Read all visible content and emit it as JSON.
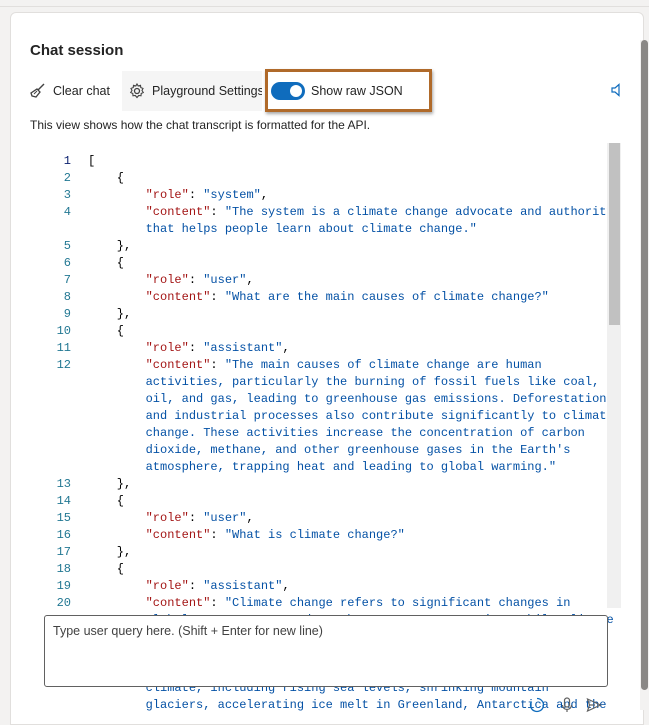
{
  "panel": {
    "title": "Chat session",
    "description": "This view shows how the chat transcript is formatted for the API."
  },
  "toolbar": {
    "clear_label": "Clear chat",
    "settings_label": "Playground Settings",
    "toggle_label": "Show raw JSON",
    "toggle_on": true
  },
  "colors": {
    "accent": "#0f6cbd",
    "highlight_border": "#b06a2a",
    "json_key": "#a31515",
    "json_string": "#0451a5",
    "line_number": "#237893"
  },
  "icons": [
    "broom-icon",
    "gear-icon",
    "speaker-icon",
    "loading-icon",
    "microphone-icon",
    "send-icon"
  ],
  "editor": {
    "lines": [
      {
        "n": "1",
        "segments": [
          [
            "p",
            "["
          ]
        ]
      },
      {
        "n": "2",
        "segments": [
          [
            "p",
            "    {"
          ]
        ]
      },
      {
        "n": "3",
        "segments": [
          [
            "p",
            "        "
          ],
          [
            "k",
            "\"role\""
          ],
          [
            "p",
            ": "
          ],
          [
            "s",
            "\"system\""
          ],
          [
            "p",
            ","
          ]
        ]
      },
      {
        "n": "4",
        "segments": [
          [
            "p",
            "        "
          ],
          [
            "k",
            "\"content\""
          ],
          [
            "p",
            ": "
          ],
          [
            "s",
            "\"The system is a climate change advocate and authority"
          ]
        ]
      },
      {
        "n": "",
        "segments": [
          [
            "s",
            "        that helps people learn about climate change.\""
          ]
        ]
      },
      {
        "n": "5",
        "segments": [
          [
            "p",
            "    },"
          ]
        ]
      },
      {
        "n": "6",
        "segments": [
          [
            "p",
            "    {"
          ]
        ]
      },
      {
        "n": "7",
        "segments": [
          [
            "p",
            "        "
          ],
          [
            "k",
            "\"role\""
          ],
          [
            "p",
            ": "
          ],
          [
            "s",
            "\"user\""
          ],
          [
            "p",
            ","
          ]
        ]
      },
      {
        "n": "8",
        "segments": [
          [
            "p",
            "        "
          ],
          [
            "k",
            "\"content\""
          ],
          [
            "p",
            ": "
          ],
          [
            "s",
            "\"What are the main causes of climate change?\""
          ]
        ]
      },
      {
        "n": "9",
        "segments": [
          [
            "p",
            "    },"
          ]
        ]
      },
      {
        "n": "10",
        "segments": [
          [
            "p",
            "    {"
          ]
        ]
      },
      {
        "n": "11",
        "segments": [
          [
            "p",
            "        "
          ],
          [
            "k",
            "\"role\""
          ],
          [
            "p",
            ": "
          ],
          [
            "s",
            "\"assistant\""
          ],
          [
            "p",
            ","
          ]
        ]
      },
      {
        "n": "12",
        "segments": [
          [
            "p",
            "        "
          ],
          [
            "k",
            "\"content\""
          ],
          [
            "p",
            ": "
          ],
          [
            "s",
            "\"The main causes of climate change are human"
          ]
        ]
      },
      {
        "n": "",
        "segments": [
          [
            "s",
            "        activities, particularly the burning of fossil fuels like coal,"
          ]
        ]
      },
      {
        "n": "",
        "segments": [
          [
            "s",
            "        oil, and gas, leading to greenhouse gas emissions. Deforestation"
          ]
        ]
      },
      {
        "n": "",
        "segments": [
          [
            "s",
            "        and industrial processes also contribute significantly to climate"
          ]
        ]
      },
      {
        "n": "",
        "segments": [
          [
            "s",
            "        change. These activities increase the concentration of carbon"
          ]
        ]
      },
      {
        "n": "",
        "segments": [
          [
            "s",
            "        dioxide, methane, and other greenhouse gases in the Earth's"
          ]
        ]
      },
      {
        "n": "",
        "segments": [
          [
            "s",
            "        atmosphere, trapping heat and leading to global warming.\""
          ]
        ]
      },
      {
        "n": "13",
        "segments": [
          [
            "p",
            "    },"
          ]
        ]
      },
      {
        "n": "14",
        "segments": [
          [
            "p",
            "    {"
          ]
        ]
      },
      {
        "n": "15",
        "segments": [
          [
            "p",
            "        "
          ],
          [
            "k",
            "\"role\""
          ],
          [
            "p",
            ": "
          ],
          [
            "s",
            "\"user\""
          ],
          [
            "p",
            ","
          ]
        ]
      },
      {
        "n": "16",
        "segments": [
          [
            "p",
            "        "
          ],
          [
            "k",
            "\"content\""
          ],
          [
            "p",
            ": "
          ],
          [
            "s",
            "\"What is climate change?\""
          ]
        ]
      },
      {
        "n": "17",
        "segments": [
          [
            "p",
            "    },"
          ]
        ]
      },
      {
        "n": "18",
        "segments": [
          [
            "p",
            "    {"
          ]
        ]
      },
      {
        "n": "19",
        "segments": [
          [
            "p",
            "        "
          ],
          [
            "k",
            "\"role\""
          ],
          [
            "p",
            ": "
          ],
          [
            "s",
            "\"assistant\""
          ],
          [
            "p",
            ","
          ]
        ]
      },
      {
        "n": "20",
        "segments": [
          [
            "p",
            "        "
          ],
          [
            "k",
            "\"content\""
          ],
          [
            "p",
            ": "
          ],
          [
            "s",
            "\"Climate change refers to significant changes in"
          ]
        ]
      },
      {
        "n": "",
        "segments": [
          [
            "s",
            "        global temperatures and weather patterns over time. While climate"
          ]
        ]
      },
      {
        "n": "",
        "segments": [
          [
            "s",
            "        "
          ]
        ]
      },
      {
        "n": "",
        "segments": [
          [
            "s",
            "        "
          ]
        ]
      },
      {
        "n": "",
        "segments": [
          [
            "s",
            "        "
          ]
        ]
      },
      {
        "n": "",
        "segments": [
          [
            "s",
            "        climate, including rising sea levels, shrinking mountain"
          ]
        ]
      },
      {
        "n": "",
        "segments": [
          [
            "s",
            "        glaciers, accelerating ice melt in Greenland, Antarctica and the"
          ]
        ]
      }
    ]
  },
  "input": {
    "placeholder": "Type user query here. (Shift + Enter for new line)",
    "value": ""
  }
}
